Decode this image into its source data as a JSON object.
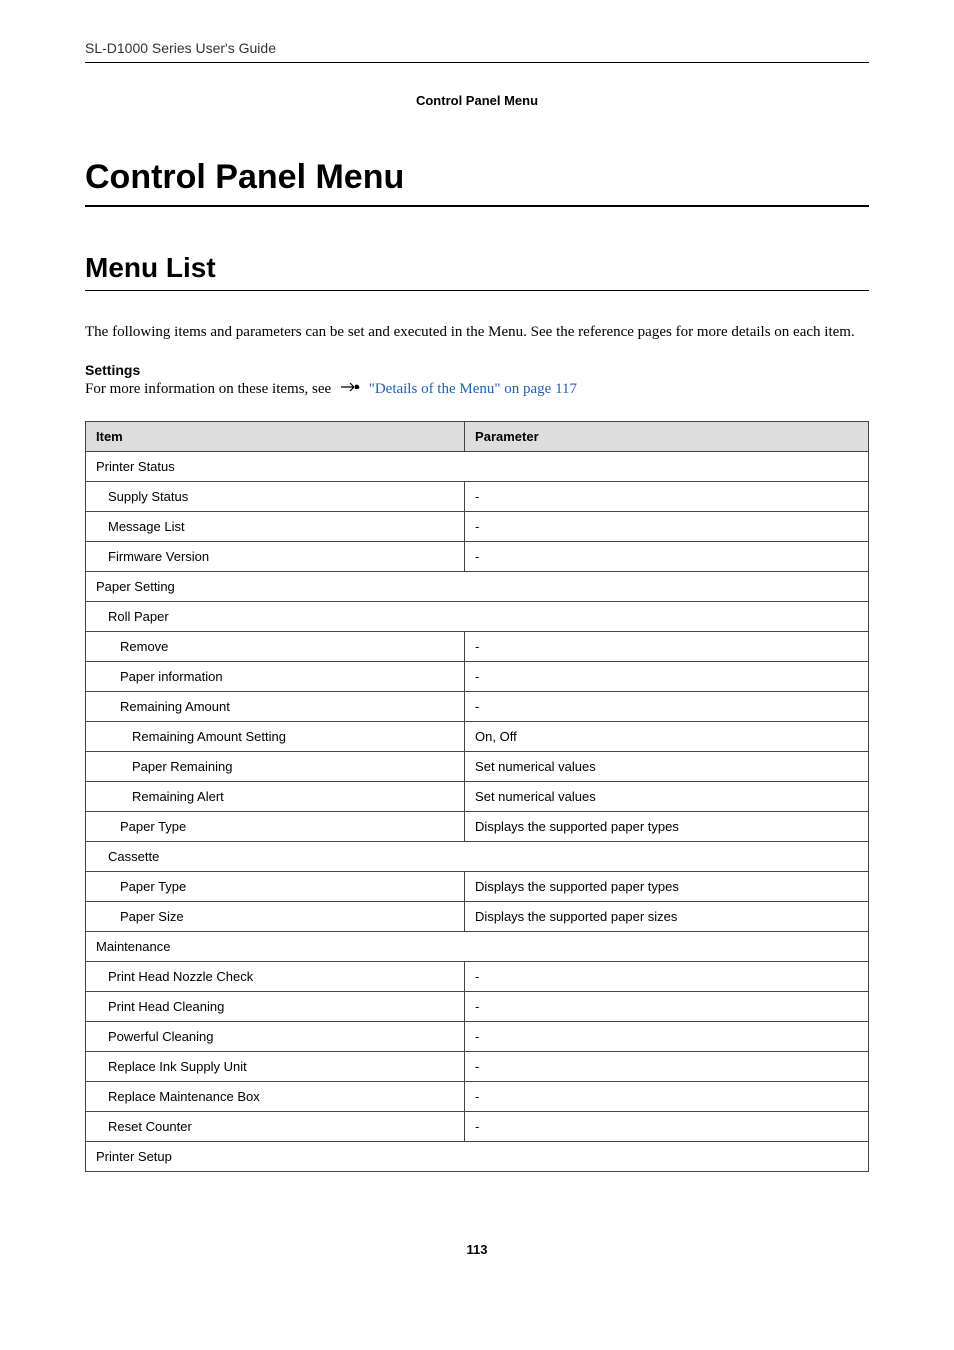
{
  "header": {
    "doc_title": "SL-D1000 Series User's Guide",
    "section_breadcrumb": "Control Panel Menu"
  },
  "h1": "Control Panel Menu",
  "h2": "Menu List",
  "intro_paragraph": "The following items and parameters can be set and executed in the Menu. See the reference pages for more details on each item.",
  "settings_label": "Settings",
  "ref_prefix": "For more information on these items, see ",
  "ref_link_text": "\"Details of the Menu\" on page 117",
  "table": {
    "head_item": "Item",
    "head_param": "Parameter",
    "rows": [
      {
        "type": "section",
        "item": "Printer Status"
      },
      {
        "indent": 1,
        "item": "Supply Status",
        "param": "-"
      },
      {
        "indent": 1,
        "item": "Message List",
        "param": "-"
      },
      {
        "indent": 1,
        "item": "Firmware Version",
        "param": "-"
      },
      {
        "type": "section",
        "indent": 0,
        "item": "Paper Setting"
      },
      {
        "type": "section",
        "indent": 1,
        "item": "Roll Paper"
      },
      {
        "indent": 2,
        "item": "Remove",
        "param": "-"
      },
      {
        "indent": 2,
        "item": "Paper information",
        "param": "-"
      },
      {
        "indent": 2,
        "item": "Remaining Amount",
        "param": "-"
      },
      {
        "indent": 3,
        "item": "Remaining Amount Setting",
        "param": "On, Off"
      },
      {
        "indent": 3,
        "item": "Paper Remaining",
        "param": "Set numerical values"
      },
      {
        "indent": 3,
        "item": "Remaining Alert",
        "param": "Set numerical values"
      },
      {
        "indent": 2,
        "item": "Paper Type",
        "param": "Displays the supported paper types"
      },
      {
        "type": "section",
        "indent": 1,
        "item": "Cassette"
      },
      {
        "indent": 2,
        "item": "Paper Type",
        "param": "Displays the supported paper types"
      },
      {
        "indent": 2,
        "item": "Paper Size",
        "param": "Displays the supported paper sizes"
      },
      {
        "type": "section",
        "indent": 0,
        "item": "Maintenance"
      },
      {
        "indent": 1,
        "item": "Print Head Nozzle Check",
        "param": "-"
      },
      {
        "indent": 1,
        "item": "Print Head Cleaning",
        "param": "-"
      },
      {
        "indent": 1,
        "item": "Powerful Cleaning",
        "param": "-"
      },
      {
        "indent": 1,
        "item": "Replace Ink Supply Unit",
        "param": "-"
      },
      {
        "indent": 1,
        "item": "Replace Maintenance Box",
        "param": "-"
      },
      {
        "indent": 1,
        "item": "Reset Counter",
        "param": "-"
      },
      {
        "type": "section",
        "indent": 0,
        "item": "Printer Setup"
      }
    ]
  },
  "page_number": "113"
}
